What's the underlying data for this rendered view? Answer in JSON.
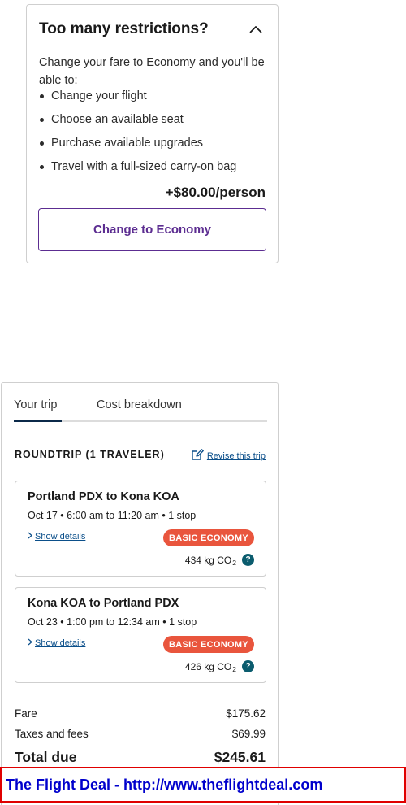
{
  "restrictions": {
    "title": "Too many restrictions?",
    "intro": "Change your fare to Economy and you'll be able to:",
    "benefits": [
      "Change your flight",
      "Choose an available seat",
      "Purchase available upgrades",
      "Travel with a full-sized carry-on bag"
    ],
    "price": "+$80.00/person",
    "button_label": "Change to Economy"
  },
  "trip": {
    "tabs": [
      {
        "label": "Your trip",
        "active": true
      },
      {
        "label": "Cost breakdown",
        "active": false
      }
    ],
    "heading": "ROUNDTRIP (1 TRAVELER)",
    "revise_label": "Revise this trip",
    "flights": [
      {
        "route": "Portland PDX to Kona KOA",
        "times": "Oct 17 • 6:00 am to 11:20 am • 1 stop",
        "details_label": "Show details",
        "badge": "BASIC ECONOMY",
        "co2_value": "434 kg CO",
        "co2_sub": "2"
      },
      {
        "route": "Kona KOA to Portland PDX",
        "times": "Oct 23 • 1:00 pm to 12:34 am • 1 stop",
        "details_label": "Show details",
        "badge": "BASIC ECONOMY",
        "co2_value": "426 kg CO",
        "co2_sub": "2"
      }
    ],
    "costs": {
      "fare_label": "Fare",
      "fare_value": "$175.62",
      "taxes_label": "Taxes and fees",
      "taxes_value": "$69.99",
      "total_label": "Total due",
      "total_value": "$245.61"
    }
  },
  "banner": {
    "text": "The Flight Deal - http://www.theflightdeal.com"
  },
  "colors": {
    "accent_purple": "#5c2d91",
    "badge_orange": "#e9553d",
    "link_blue": "#0b4f8a",
    "tab_active": "#0b2949",
    "banner_border": "#e00000",
    "banner_text": "#0000cc"
  },
  "icons": {
    "collapse": "chevron-up-icon",
    "revise": "edit-icon",
    "details": "chevron-right-icon",
    "co2_help": "help-icon"
  }
}
